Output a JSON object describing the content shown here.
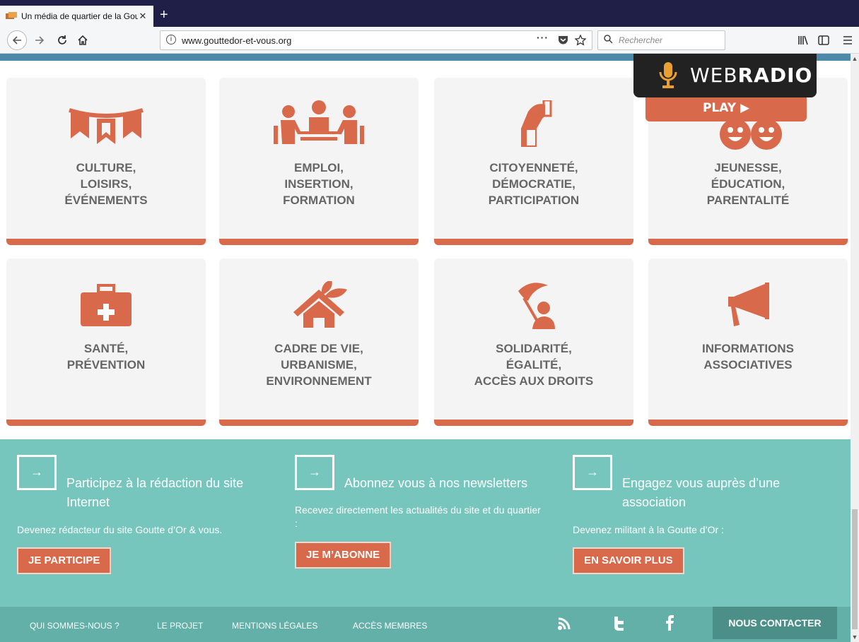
{
  "browser": {
    "tab_title": "Un média de quartier de la Gout",
    "tab_close": "✕",
    "new_tab": "+",
    "url": "www.gouttedor-et-vous.org",
    "search_placeholder": "Rechercher",
    "icons": [
      "back-arrow",
      "forward-arrow",
      "reload",
      "home",
      "page-actions",
      "pocket",
      "bookmark-star",
      "search",
      "library",
      "sidebar",
      "menu"
    ]
  },
  "webradio": {
    "label_light": "WEB",
    "label_bold": "RADIO",
    "play": "PLAY ▶"
  },
  "categories": [
    {
      "label": "CULTURE,\nLOISIRS,\nÉVÉNEMENTS",
      "icon": "bunting-icon"
    },
    {
      "label": "EMPLOI,\nINSERTION,\nFORMATION",
      "icon": "meeting-icon"
    },
    {
      "label": "CITOYENNETÉ,\nDÉMOCRATIE,\nPARTICIPATION",
      "icon": "ballot-hand-icon"
    },
    {
      "label": "JEUNESSE,\nÉDUCATION,\nPARENTALITÉ",
      "icon": "smiley-faces-icon"
    },
    {
      "label": "SANTÉ,\nPRÉVENTION",
      "icon": "first-aid-kit-icon"
    },
    {
      "label": "CADRE DE VIE,\nURBANISME,\nENVIRONNEMENT",
      "icon": "house-leaf-icon"
    },
    {
      "label": "SOLIDARITÉ,\nÉGALITÉ,\nACCÈS AUX DROITS",
      "icon": "person-flag-icon"
    },
    {
      "label": "INFORMATIONS\nASSOCIATIVES",
      "icon": "megaphone-icon"
    }
  ],
  "promo": [
    {
      "arrow": "→",
      "title": "Participez à la rédaction du site Internet",
      "desc": "Devenez rédacteur du site Goutte d’Or & vous.",
      "button": "JE PARTICIPE"
    },
    {
      "arrow": "→",
      "title": "Abonnez vous à nos newsletters",
      "desc": "Recevez directement les actualités du site et du quartier :",
      "button": "JE M’ABONNE"
    },
    {
      "arrow": "→",
      "title": "Engagez vous auprès d’une association",
      "desc": "Devenez militant à la Goutte d’Or :",
      "button": "EN SAVOIR PLUS"
    }
  ],
  "footer": {
    "links": [
      "QUI SOMMES-NOUS ?",
      "LE PROJET",
      "MENTIONS LÉGALES",
      "ACCÈS MEMBRES"
    ],
    "social": [
      "rss-icon",
      "twitter-icon",
      "facebook-icon"
    ],
    "contact": "NOUS CONTACTER"
  },
  "colors": {
    "accent": "#d8694a",
    "teal": "#76c6be",
    "teal_dark": "#62b0a8",
    "card_bg": "#f4f4f4",
    "strip": "#4d8aa9",
    "tab_bar": "#1f1f47"
  }
}
